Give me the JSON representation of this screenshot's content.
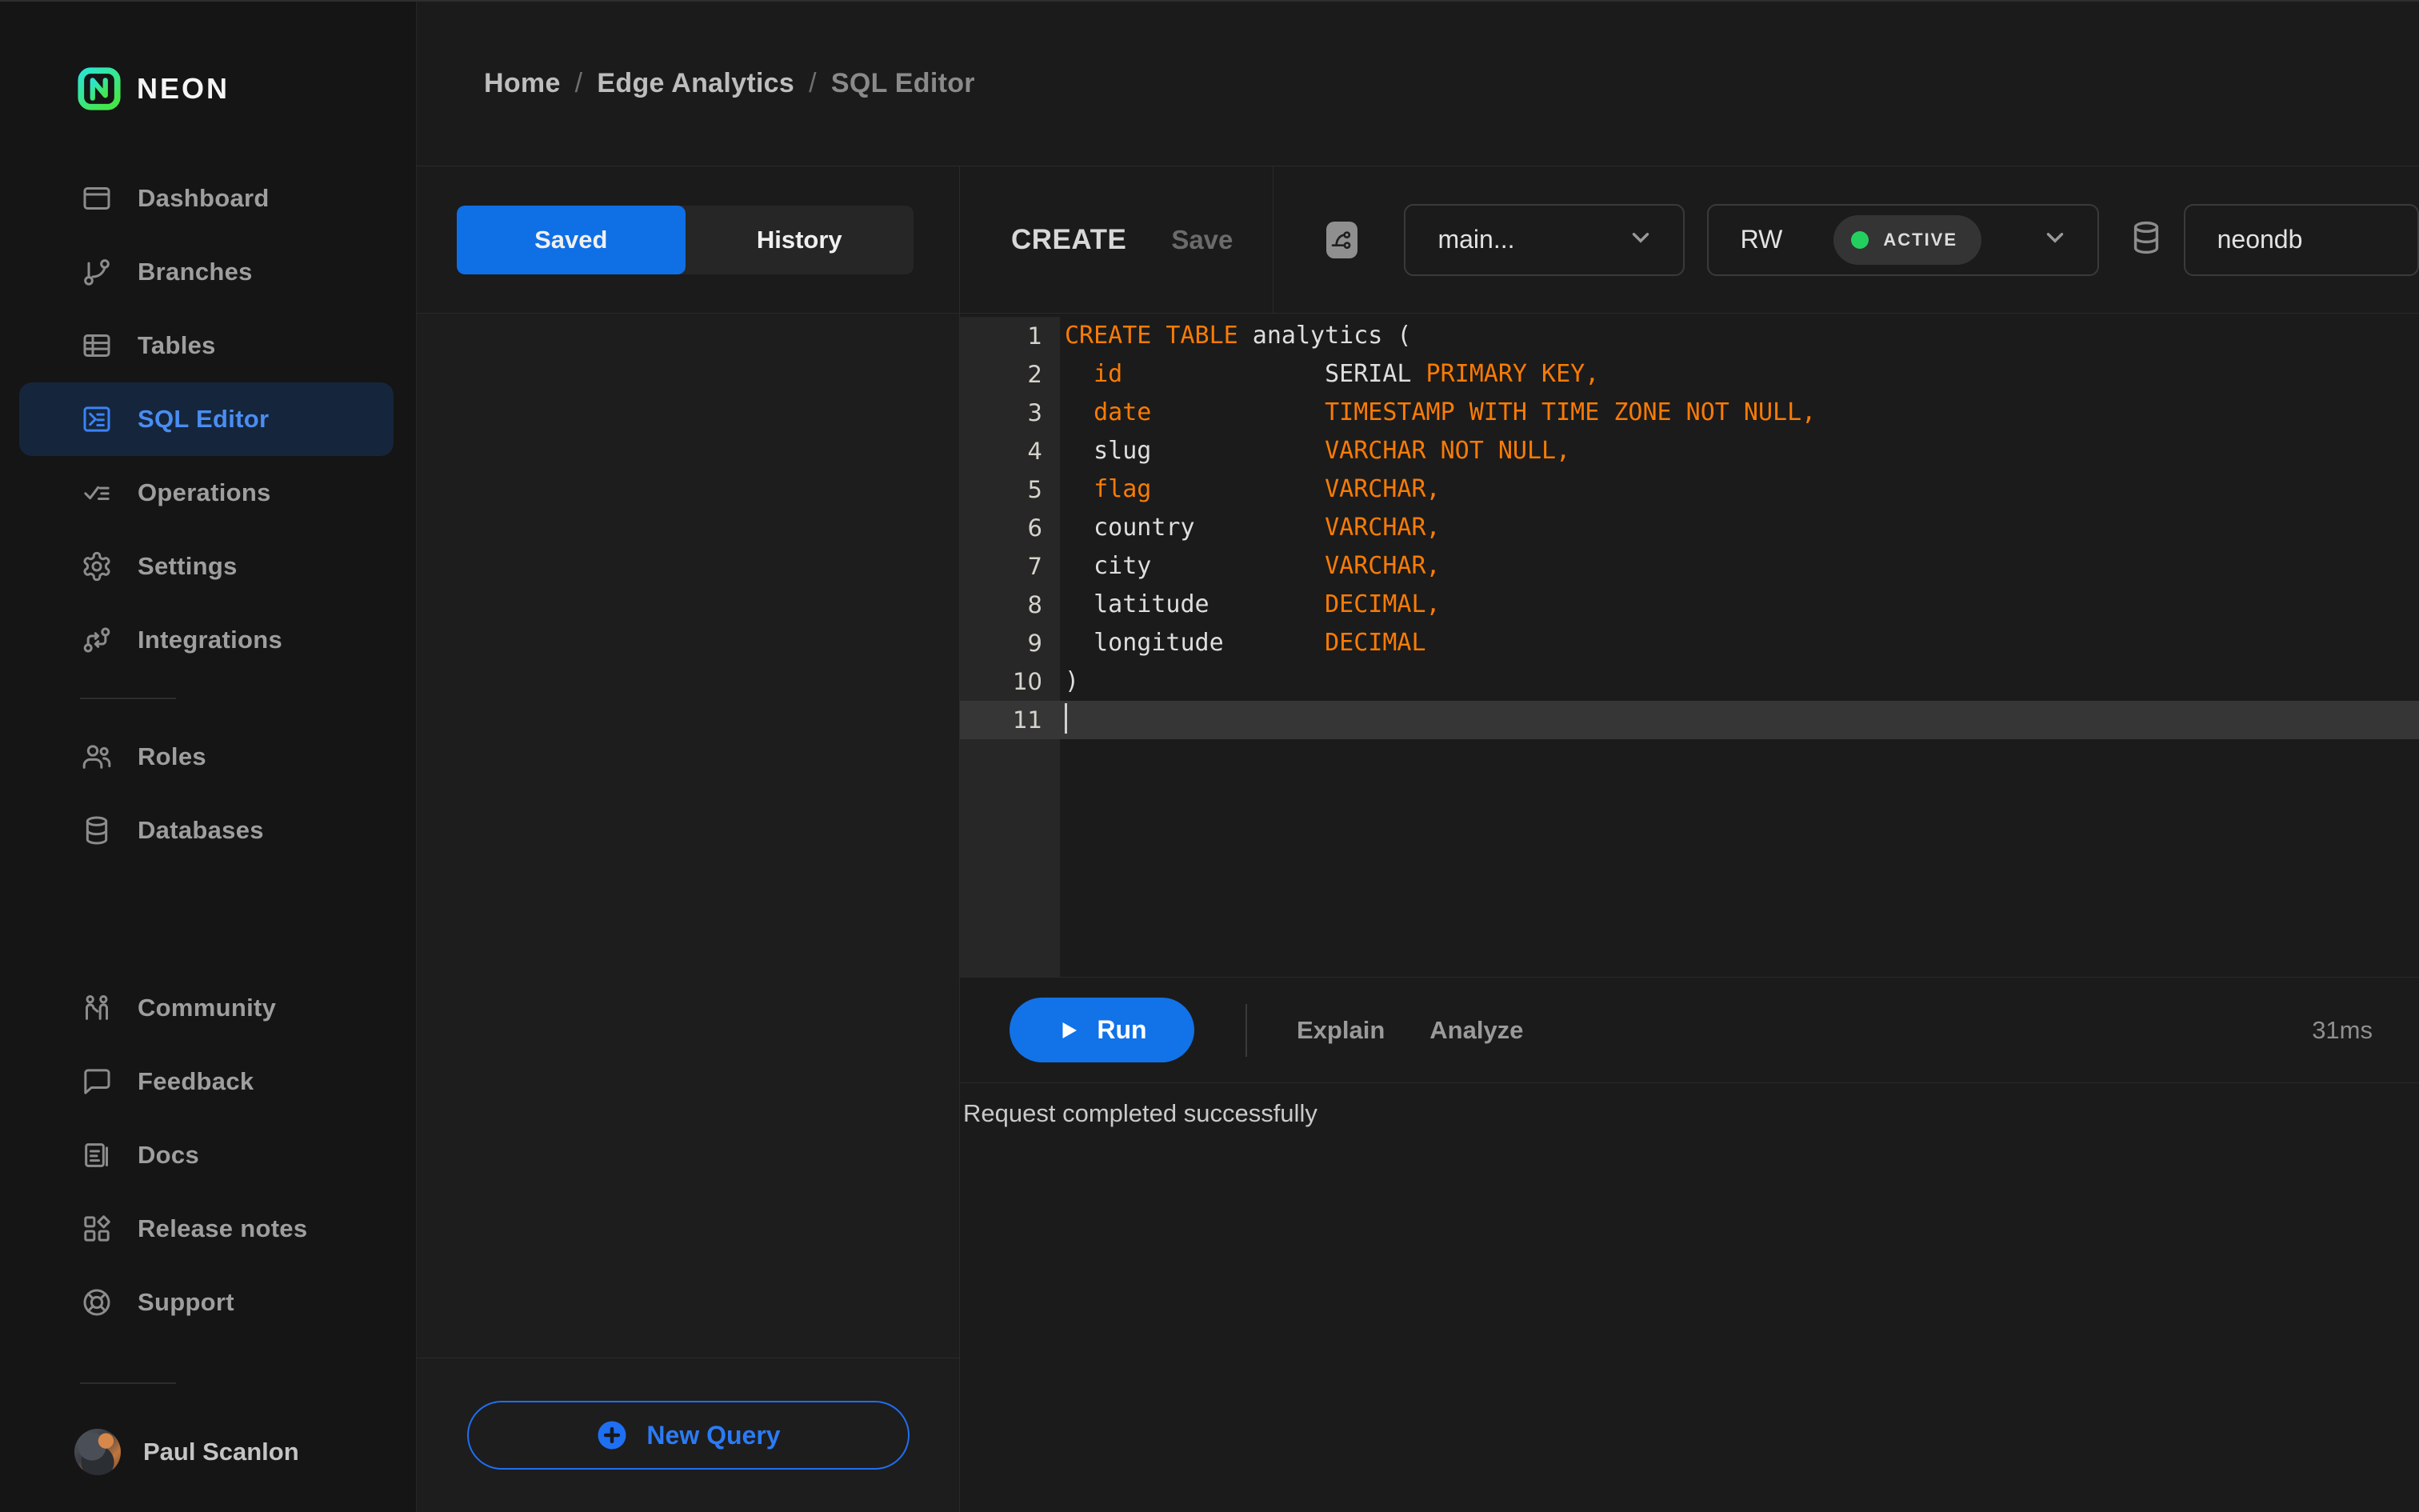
{
  "brand": {
    "wordmark": "NEON"
  },
  "breadcrumb": {
    "items": [
      "Home",
      "Edge Analytics",
      "SQL Editor"
    ],
    "separator": "/"
  },
  "sidebar": {
    "nav_main": [
      {
        "label": "Dashboard",
        "icon": "dashboard-icon",
        "active": false
      },
      {
        "label": "Branches",
        "icon": "branches-icon",
        "active": false
      },
      {
        "label": "Tables",
        "icon": "tables-icon",
        "active": false
      },
      {
        "label": "SQL Editor",
        "icon": "sql-editor-icon",
        "active": true
      },
      {
        "label": "Operations",
        "icon": "operations-icon",
        "active": false
      },
      {
        "label": "Settings",
        "icon": "settings-icon",
        "active": false
      },
      {
        "label": "Integrations",
        "icon": "integrations-icon",
        "active": false
      }
    ],
    "nav_secondary": [
      {
        "label": "Roles",
        "icon": "roles-icon",
        "active": false
      },
      {
        "label": "Databases",
        "icon": "databases-icon",
        "active": false
      }
    ],
    "nav_tertiary": [
      {
        "label": "Community",
        "icon": "community-icon",
        "active": false
      },
      {
        "label": "Feedback",
        "icon": "feedback-icon",
        "active": false
      },
      {
        "label": "Docs",
        "icon": "docs-icon",
        "active": false
      },
      {
        "label": "Release notes",
        "icon": "release-notes-icon",
        "active": false
      },
      {
        "label": "Support",
        "icon": "support-icon",
        "active": false
      }
    ],
    "user": {
      "name": "Paul Scanlon"
    }
  },
  "tabs": {
    "saved": "Saved",
    "history": "History"
  },
  "editor_toolbar": {
    "query_title": "CREATE",
    "save_label": "Save",
    "branch_selected": "main...",
    "compute_selected": "RW",
    "compute_status": "ACTIVE",
    "database_selected": "neondb"
  },
  "editor": {
    "active_line": 11,
    "lines": [
      {
        "num": 1,
        "segments": [
          {
            "c": "kw",
            "t": "CREATE TABLE"
          },
          {
            "c": "pl",
            "t": " analytics ("
          }
        ]
      },
      {
        "num": 2,
        "segments": [
          {
            "c": "pl",
            "t": "  "
          },
          {
            "c": "kw",
            "t": "id"
          },
          {
            "c": "pl",
            "t": "              SERIAL"
          },
          {
            "c": "kw",
            "t": " PRIMARY KEY,"
          }
        ]
      },
      {
        "num": 3,
        "segments": [
          {
            "c": "pl",
            "t": "  "
          },
          {
            "c": "kw",
            "t": "date"
          },
          {
            "c": "pl",
            "t": "            "
          },
          {
            "c": "kw",
            "t": "TIMESTAMP WITH TIME ZONE NOT NULL,"
          }
        ]
      },
      {
        "num": 4,
        "segments": [
          {
            "c": "pl",
            "t": "  slug            "
          },
          {
            "c": "kw",
            "t": "VARCHAR NOT NULL,"
          }
        ]
      },
      {
        "num": 5,
        "segments": [
          {
            "c": "pl",
            "t": "  "
          },
          {
            "c": "kw",
            "t": "flag"
          },
          {
            "c": "pl",
            "t": "            "
          },
          {
            "c": "kw",
            "t": "VARCHAR,"
          }
        ]
      },
      {
        "num": 6,
        "segments": [
          {
            "c": "pl",
            "t": "  country         "
          },
          {
            "c": "kw",
            "t": "VARCHAR,"
          }
        ]
      },
      {
        "num": 7,
        "segments": [
          {
            "c": "pl",
            "t": "  city            "
          },
          {
            "c": "kw",
            "t": "VARCHAR,"
          }
        ]
      },
      {
        "num": 8,
        "segments": [
          {
            "c": "pl",
            "t": "  latitude        "
          },
          {
            "c": "kw",
            "t": "DECIMAL,"
          }
        ]
      },
      {
        "num": 9,
        "segments": [
          {
            "c": "pl",
            "t": "  longitude       "
          },
          {
            "c": "kw",
            "t": "DECIMAL"
          }
        ]
      },
      {
        "num": 10,
        "segments": [
          {
            "c": "pl",
            "t": ")"
          }
        ]
      },
      {
        "num": 11,
        "segments": []
      }
    ]
  },
  "run_bar": {
    "run": "Run",
    "explain": "Explain",
    "analyze": "Analyze",
    "duration": "31ms"
  },
  "status": {
    "message": "Request completed successfully"
  },
  "saved_panel": {
    "new_query": "New Query"
  },
  "colors": {
    "accent_blue": "#0f6fe5",
    "neon_green": "#00e599",
    "code_keyword_orange": "#f97b05",
    "active_status_green": "#23d05f"
  }
}
